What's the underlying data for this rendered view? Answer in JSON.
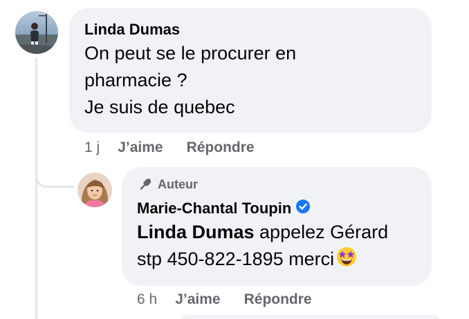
{
  "comment": {
    "author": "Linda Dumas",
    "lines": [
      "On peut se le procurer en",
      "pharmacie ?",
      "Je suis de quebec"
    ],
    "time": "1 j",
    "like_label": "J’aime",
    "reply_label": "Répondre"
  },
  "reply": {
    "badge": "Auteur",
    "author": "Marie-Chantal Toupin",
    "verified_color": "#1877f2",
    "mention": "Linda Dumas",
    "text_line1_rest": " appelez Gérard",
    "text_line2": "stp 450-822-1895 merci",
    "emoji": "star-struck-emoji",
    "time": "6 h",
    "like_label": "J’aime",
    "reply_label": "Répondre"
  },
  "colors": {
    "bubble_bg": "#f0f2f5",
    "secondary_text": "#65676b",
    "primary_text": "#050505"
  }
}
